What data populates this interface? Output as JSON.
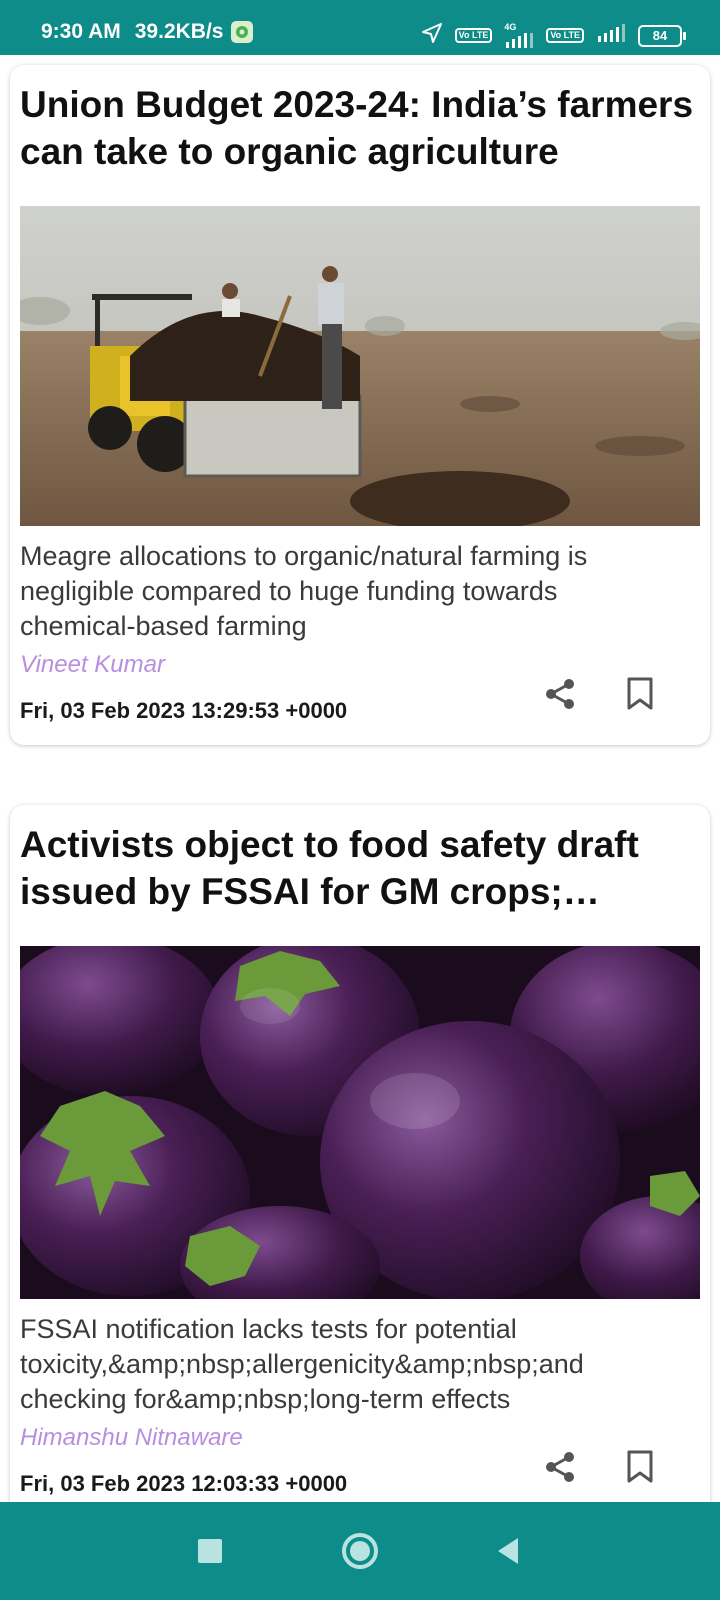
{
  "status_bar": {
    "time": "9:30 AM",
    "speed": "39.2KB/s",
    "network_label": "4G",
    "volte_1": "Vo LTE",
    "volte_2": "Vo LTE",
    "battery": "84"
  },
  "articles": [
    {
      "title": "Union Budget 2023-24: India’s farmers can take to organic agriculture",
      "image": "tractor-manure-field",
      "summary": "Meagre allocations to organic/natural farming is negligible compared to huge funding towards chemical-based farming",
      "author": "Vineet Kumar",
      "date": "Fri, 03 Feb 2023 13:29:53 +0000"
    },
    {
      "title": "Activists object to food safety draft issued by FSSAI for GM crops; demand",
      "image": "purple-eggplants",
      "summary": "FSSAI notification lacks tests for potential toxicity,&amp;nbsp;allergenicity&amp;nbsp;and checking for&amp;nbsp;long-term effects",
      "author": "Himanshu Nitnaware",
      "date": "Fri, 03 Feb 2023 12:03:33 +0000"
    }
  ],
  "icons": {
    "share": "share-icon",
    "bookmark": "bookmark-icon",
    "location": "location-arrow-icon",
    "recent": "square-icon",
    "home": "circle-icon",
    "back": "triangle-back-icon"
  },
  "colors": {
    "accent": "#0e8c8a",
    "author": "#b98de0"
  }
}
